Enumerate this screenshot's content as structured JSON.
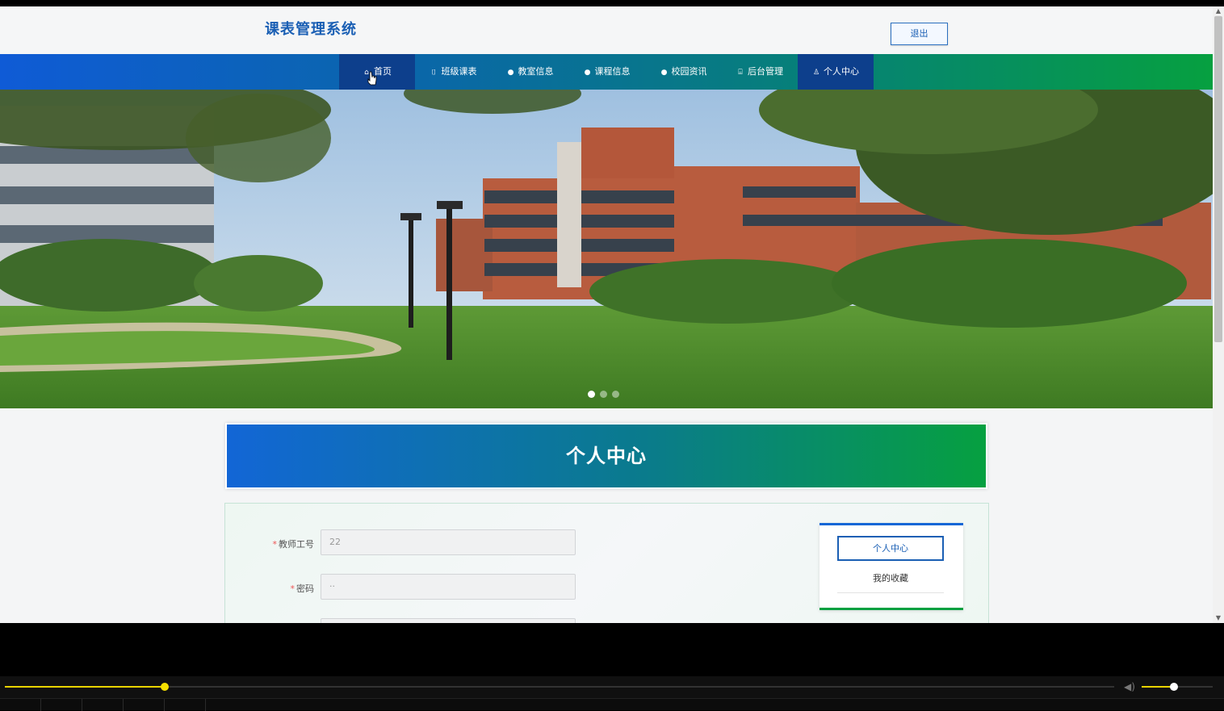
{
  "header": {
    "site_title": "课表管理系统",
    "logout_label": "退出"
  },
  "nav": {
    "items": [
      {
        "label": "首页",
        "icon": "home-icon"
      },
      {
        "label": "班级课表",
        "icon": "bag-icon"
      },
      {
        "label": "教室信息",
        "icon": "info-icon"
      },
      {
        "label": "课程信息",
        "icon": "info-icon"
      },
      {
        "label": "校园资讯",
        "icon": "info-icon"
      },
      {
        "label": "后台管理",
        "icon": "briefcase-icon"
      },
      {
        "label": "个人中心",
        "icon": "user-icon"
      }
    ],
    "active": [
      "首页",
      "个人中心"
    ]
  },
  "banner": {
    "slides": 3,
    "current_slide": 1
  },
  "panel": {
    "title": "个人中心"
  },
  "form": {
    "fields": [
      {
        "label": "教师工号",
        "required": true,
        "value": "22"
      },
      {
        "label": "密码",
        "required": true,
        "value": "··"
      }
    ]
  },
  "side_menu": {
    "items": [
      "个人中心",
      "我的收藏"
    ],
    "active": "个人中心"
  },
  "player": {
    "progress": 0.144,
    "volume": 0.45
  },
  "colors": {
    "brand_blue": "#1a5fb4",
    "nav_active": "#0d3f8c",
    "accent_green": "#06a040",
    "player_yellow": "#e9d400"
  }
}
